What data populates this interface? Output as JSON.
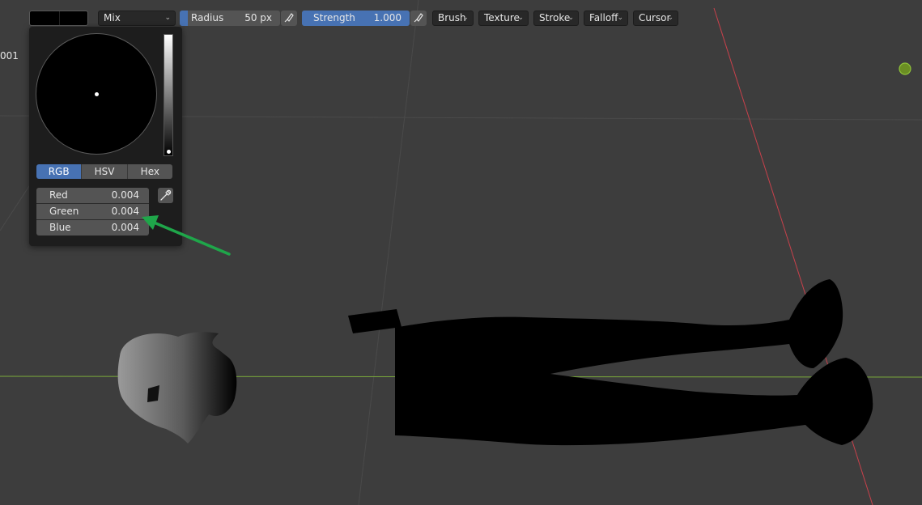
{
  "toolbar": {
    "blend_mode": "Mix",
    "radius": {
      "label": "Radius",
      "value": "50 px",
      "fill_fraction": 0.05
    },
    "strength": {
      "label": "Strength",
      "value": "1.000",
      "fill_fraction": 1.0
    },
    "menus": [
      "Brush",
      "Texture",
      "Stroke",
      "Falloff",
      "Cursor"
    ]
  },
  "side_text": "001",
  "color_picker": {
    "tabs": [
      "RGB",
      "HSV",
      "Hex"
    ],
    "active_tab": "RGB",
    "channels": [
      {
        "label": "Red",
        "value": "0.004"
      },
      {
        "label": "Green",
        "value": "0.004"
      },
      {
        "label": "Blue",
        "value": "0.004"
      }
    ]
  },
  "colors": {
    "viewport_bg": "#3d3d3d",
    "accent_blue": "#4772b3",
    "x_axis_red": "#c8414b",
    "y_axis_green": "#7bab3a",
    "annotation_arrow": "#1fa64a"
  },
  "icons": [
    "pressure-icon",
    "eyedropper-icon",
    "chevron-down-icon",
    "navigation-gizmo-icon"
  ]
}
